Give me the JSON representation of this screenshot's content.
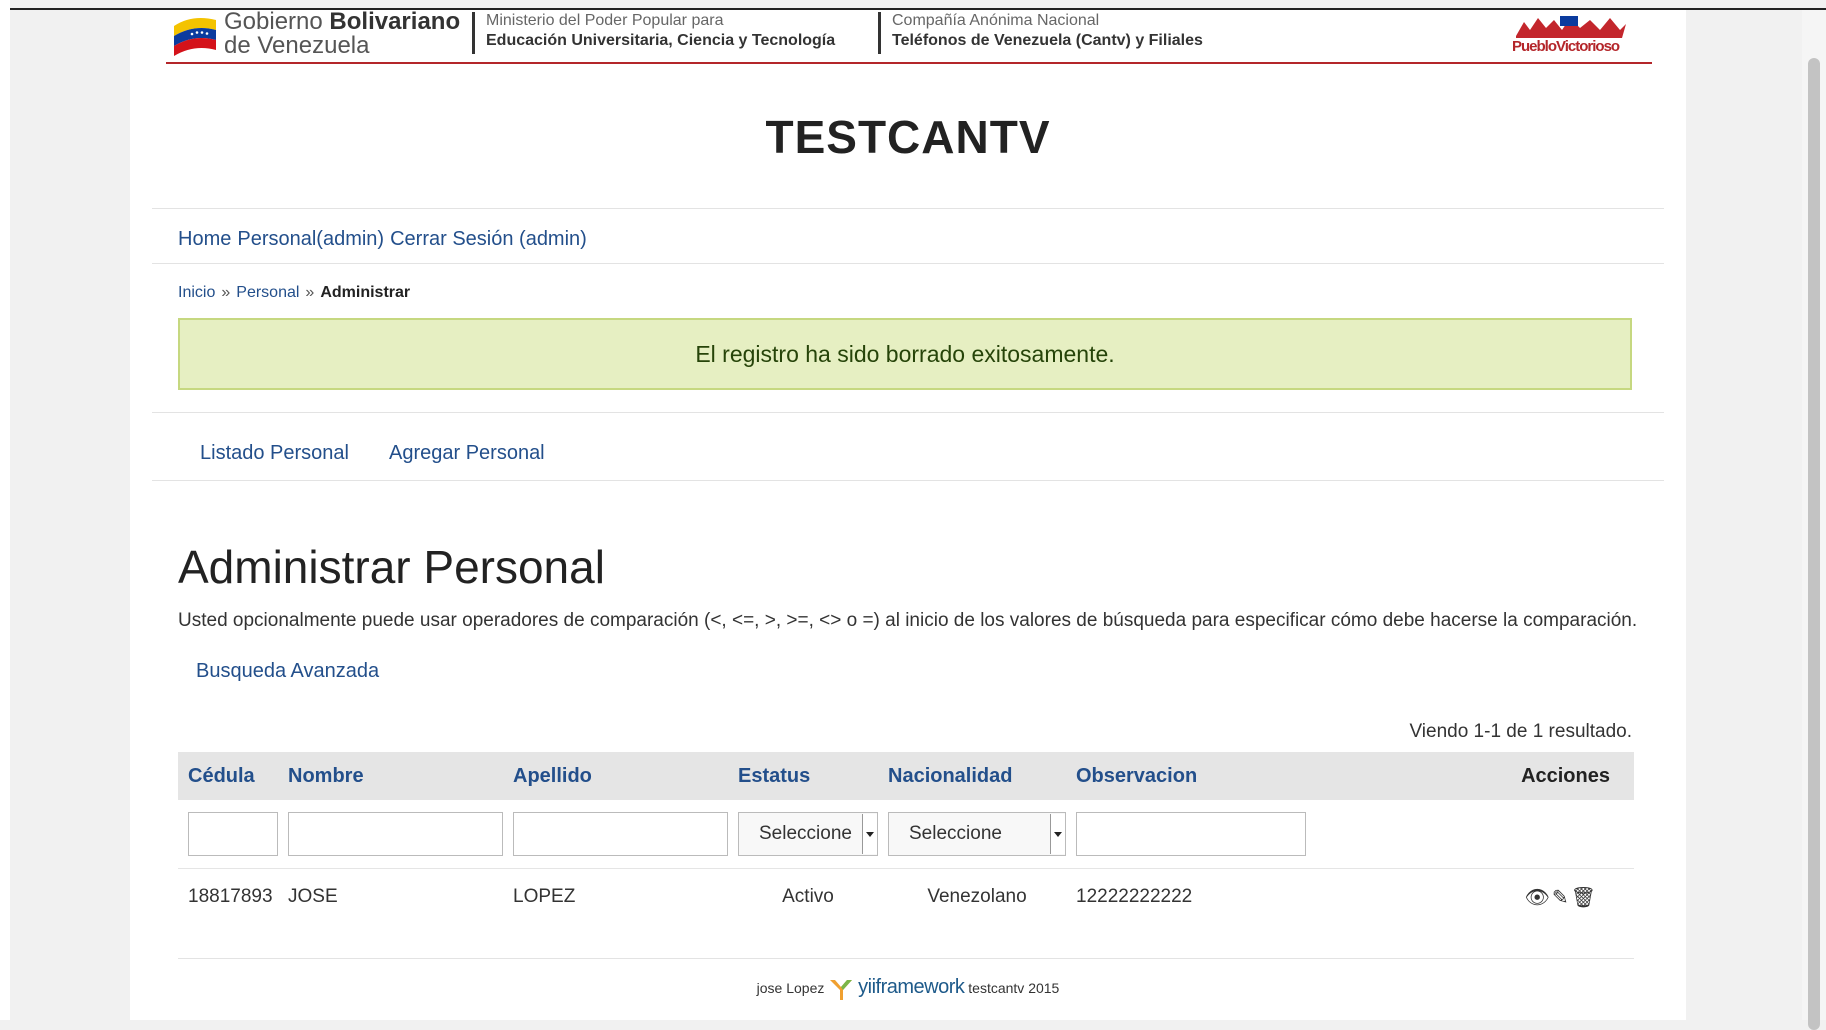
{
  "banner": {
    "gov_line1_a": "Gobierno",
    "gov_line1_b": "Bolivariano",
    "gov_line2": "de Venezuela",
    "ministry_line1": "Ministerio del Poder Popular para",
    "ministry_line2": "Educación Universitaria, Ciencia y Tecnología",
    "cantv_line1": "Compañía  Anónima Nacional",
    "cantv_line2": "Teléfonos de Venezuela (Cantv) y Filiales",
    "pueblo_logo_text": "PuebloVictorioso"
  },
  "site_title": "TESTCANTV",
  "mainmenu": {
    "home": "Home",
    "personal": "Personal(admin)",
    "logout": "Cerrar Sesión (admin)"
  },
  "breadcrumb": {
    "inicio": "Inicio",
    "sep": "»",
    "personal": "Personal",
    "current": "Administrar"
  },
  "flash_message": "El registro ha sido borrado exitosamente.",
  "operations": {
    "list": "Listado Personal",
    "add": "Agregar Personal"
  },
  "page_heading": "Administrar Personal",
  "note": "Usted opcionalmente puede usar operadores de comparación (<, <=, >, >=, <> o =) al inicio de los valores de búsqueda para especificar cómo debe hacerse la comparación.",
  "advanced_search": "Busqueda Avanzada",
  "summary": "Viendo 1-1 de 1 resultado.",
  "grid": {
    "headers": {
      "cedula": "Cédula",
      "nombre": "Nombre",
      "apellido": "Apellido",
      "estatus": "Estatus",
      "nacionalidad": "Nacionalidad",
      "observacion": "Observacion",
      "acciones": "Acciones"
    },
    "filters": {
      "estatus_select": "Seleccione",
      "nacionalidad_select": "Seleccione"
    },
    "rows": [
      {
        "cedula": "18817893",
        "nombre": "JOSE",
        "apellido": "LOPEZ",
        "estatus": "Activo",
        "nacionalidad": "Venezolano",
        "observacion": "12222222222"
      }
    ]
  },
  "footer": {
    "author": "jose Lopez",
    "framework": "yiiframework",
    "suffix": "testcantv 2015"
  }
}
